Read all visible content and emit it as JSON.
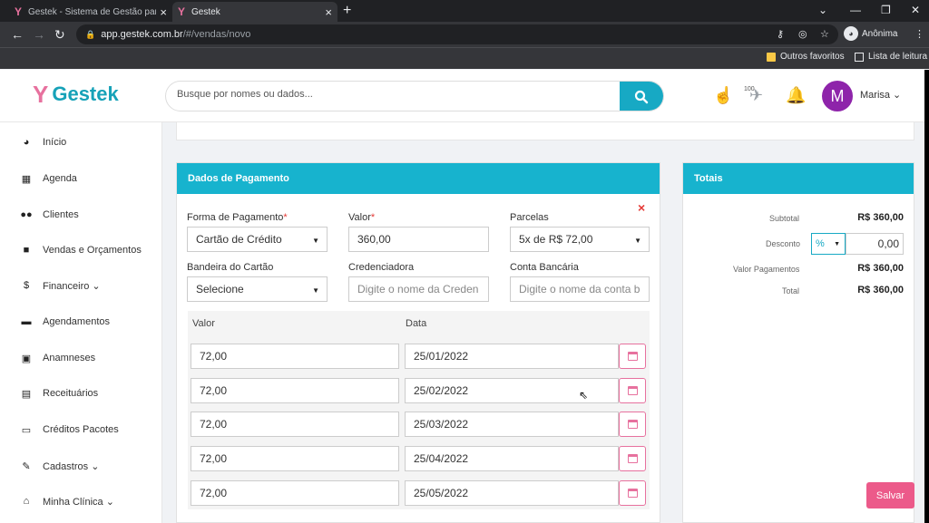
{
  "browser": {
    "tabs": [
      {
        "title": "Gestek - Sistema de Gestão para"
      },
      {
        "title": "Gestek"
      }
    ],
    "url_host": "app.gestek.com.br",
    "url_path": "/#/vendas/novo",
    "profile_label": "Anônima",
    "bookmarks": {
      "other": "Outros favoritos",
      "reading": "Lista de leitura"
    }
  },
  "app": {
    "logo": "Gestek",
    "search_placeholder": "Busque por nomes ou dados...",
    "notification_count": "100",
    "user": {
      "initial": "M",
      "name": "Marisa ⌄"
    }
  },
  "sidebar": {
    "items": [
      {
        "label": "Início",
        "icon": "dashboard-icon"
      },
      {
        "label": "Agenda",
        "icon": "calendar-icon"
      },
      {
        "label": "Clientes",
        "icon": "users-icon"
      },
      {
        "label": "Vendas e Orçamentos",
        "icon": "shopping-bag-icon"
      },
      {
        "label": "Financeiro ⌄",
        "icon": "dollar-icon"
      },
      {
        "label": "Agendamentos",
        "icon": "calendar-icon"
      },
      {
        "label": "Anamneses",
        "icon": "id-card-icon"
      },
      {
        "label": "Receituários",
        "icon": "file-icon"
      },
      {
        "label": "Créditos Pacotes",
        "icon": "credit-card-icon"
      },
      {
        "label": "Cadastros ⌄",
        "icon": "edit-icon"
      },
      {
        "label": "Minha Clínica ⌄",
        "icon": "home-icon"
      }
    ]
  },
  "payment": {
    "title": "Dados de Pagamento",
    "forma_label": "Forma de Pagamento",
    "forma_value": "Cartão de Crédito",
    "valor_label": "Valor",
    "valor_value": "360,00",
    "parcelas_label": "Parcelas",
    "parcelas_value": "5x de R$ 72,00",
    "bandeira_label": "Bandeira do Cartão",
    "bandeira_value": "Selecione",
    "credenciadora_label": "Credenciadora",
    "credenciadora_placeholder": "Digite o nome da Creden",
    "conta_label": "Conta Bancária",
    "conta_placeholder": "Digite o nome da conta b",
    "table_headers": {
      "valor": "Valor",
      "data": "Data"
    },
    "installments": [
      {
        "valor": "72,00",
        "data": "25/01/2022"
      },
      {
        "valor": "72,00",
        "data": "25/02/2022"
      },
      {
        "valor": "72,00",
        "data": "25/03/2022"
      },
      {
        "valor": "72,00",
        "data": "25/04/2022"
      },
      {
        "valor": "72,00",
        "data": "25/05/2022"
      }
    ]
  },
  "totals": {
    "title": "Totais",
    "subtotal_label": "Subtotal",
    "subtotal_value": "R$ 360,00",
    "desconto_label": "Desconto",
    "desconto_type": "%",
    "desconto_value": "0,00",
    "pagamentos_label": "Valor Pagamentos",
    "pagamentos_value": "R$ 360,00",
    "total_label": "Total",
    "total_value": "R$ 360,00"
  },
  "actions": {
    "save": "Salvar"
  },
  "colors": {
    "accent": "#17b3ce",
    "pink": "#e7719e",
    "save": "#ec5a8a",
    "avatar": "#8e24aa"
  }
}
